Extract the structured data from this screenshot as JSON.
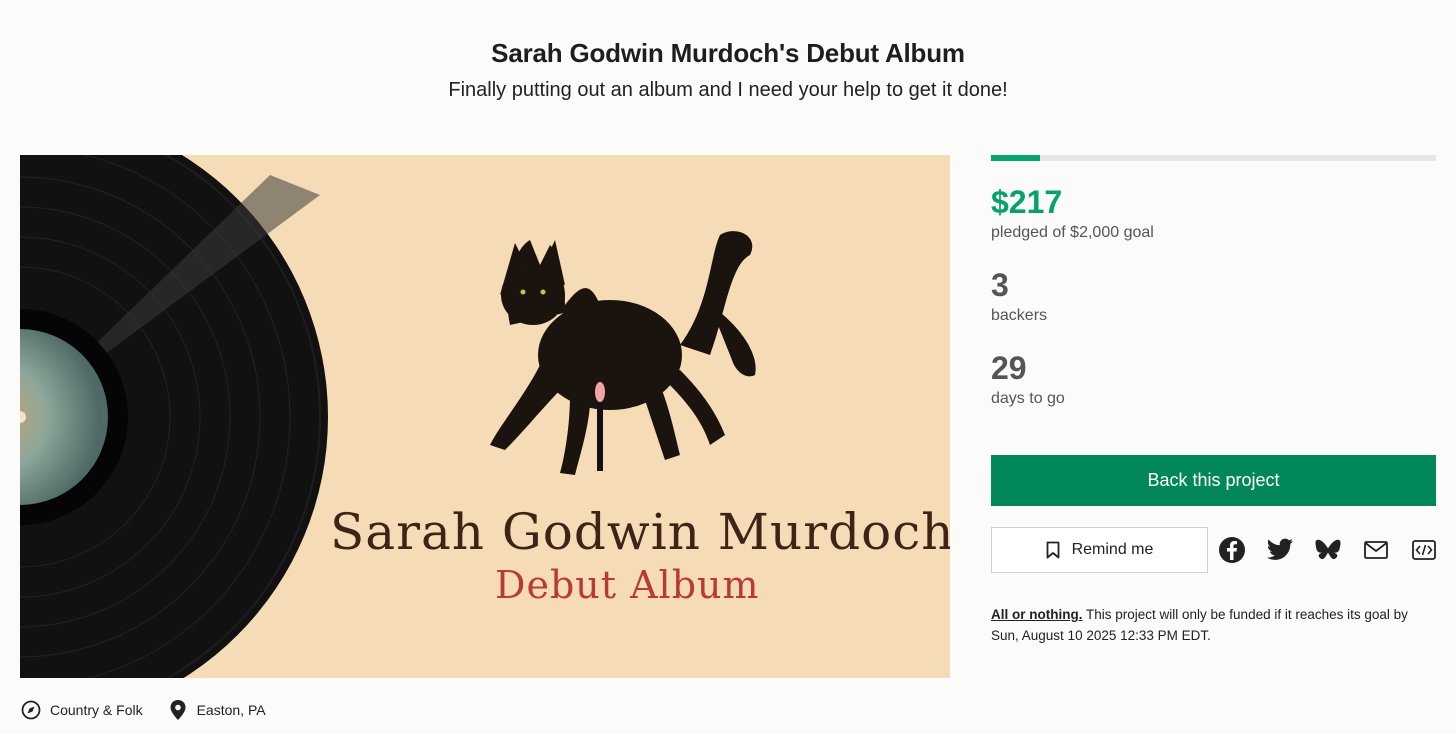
{
  "project": {
    "title": "Sarah Godwin Murdoch's Debut Album",
    "blurb": "Finally putting out an album and I need your help to get it done!"
  },
  "artwork": {
    "artist_text": "Sarah Godwin Murdoch",
    "album_text": "Debut Album"
  },
  "stats": {
    "progress_fraction": 0.11,
    "pledged_amount": "$217",
    "pledged_label": "pledged of $2,000 goal",
    "backers_count": "3",
    "backers_label": "backers",
    "days_count": "29",
    "days_label": "days to go"
  },
  "actions": {
    "back_label": "Back this project",
    "remind_label": "Remind me",
    "share_icons": [
      "facebook-icon",
      "twitter-icon",
      "bluesky-icon",
      "email-icon",
      "embed-icon"
    ]
  },
  "funding_note": {
    "lead": "All or nothing.",
    "text": " This project will only be funded if it reaches its goal by Sun, August 10 2025 12:33 PM EDT."
  },
  "meta": {
    "category": "Country & Folk",
    "location": "Easton, PA"
  },
  "colors": {
    "accent": "#05a36d",
    "button": "#028858",
    "background": "#fbfbfa"
  }
}
